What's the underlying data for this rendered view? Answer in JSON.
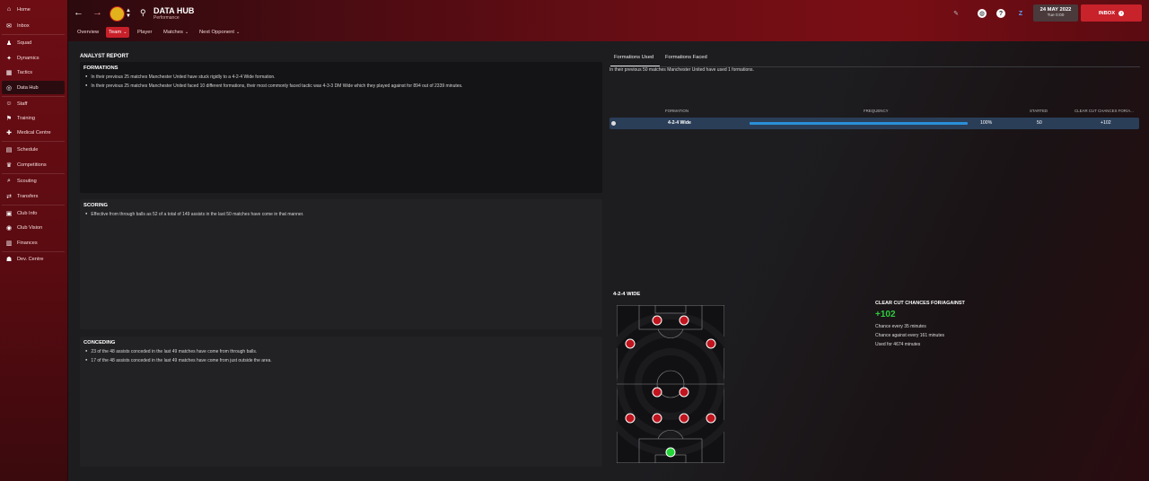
{
  "sidebar": {
    "items": [
      {
        "label": "Home",
        "icon": "home-icon",
        "glyph": "⌂"
      },
      {
        "label": "Inbox",
        "icon": "inbox-icon",
        "glyph": "✉"
      },
      {
        "label": "Squad",
        "icon": "squad-icon",
        "glyph": "♟"
      },
      {
        "label": "Dynamics",
        "icon": "dynamics-icon",
        "glyph": "✦"
      },
      {
        "label": "Tactics",
        "icon": "tactics-icon",
        "glyph": "▦"
      },
      {
        "label": "Data Hub",
        "icon": "data-hub-icon",
        "glyph": "◎"
      },
      {
        "label": "Staff",
        "icon": "staff-icon",
        "glyph": "☺"
      },
      {
        "label": "Training",
        "icon": "training-icon",
        "glyph": "⚑"
      },
      {
        "label": "Medical Centre",
        "icon": "medical-icon",
        "glyph": "✚"
      },
      {
        "label": "Schedule",
        "icon": "schedule-icon",
        "glyph": "▤"
      },
      {
        "label": "Competitions",
        "icon": "trophy-icon",
        "glyph": "♛"
      },
      {
        "label": "Scouting",
        "icon": "scouting-icon",
        "glyph": "⌕"
      },
      {
        "label": "Transfers",
        "icon": "transfers-icon",
        "glyph": "⇄"
      },
      {
        "label": "Club Info",
        "icon": "club-info-icon",
        "glyph": "▣"
      },
      {
        "label": "Club Vision",
        "icon": "club-vision-icon",
        "glyph": "◉"
      },
      {
        "label": "Finances",
        "icon": "finances-icon",
        "glyph": "▥"
      },
      {
        "label": "Dev. Centre",
        "icon": "dev-centre-icon",
        "glyph": "☗"
      }
    ]
  },
  "header": {
    "title": "DATA HUB",
    "subtitle": "Performance",
    "tabs": [
      "Overview",
      "Team",
      "Player",
      "Matches",
      "Next Opponent"
    ],
    "date": "24 MAY 2022",
    "day": "Tue 0:00",
    "inbox_label": "INBOX"
  },
  "report": {
    "heading": "ANALYST REPORT",
    "formations": {
      "title": "FORMATIONS",
      "bullets": [
        "In their previous 25 matches Manchester United have stuck rigidly to a 4-2-4 Wide formation.",
        "In their previous 25 matches Manchester United faced 10 different formations, their most commonly faced tactic was 4-3-3 DM Wide which they played against for 894 out of 2339 minutes."
      ]
    },
    "scoring": {
      "title": "SCORING",
      "bullets": [
        "Effective from through balls as 52 of a total of 149 assists in the last 50 matches have come in that manner."
      ]
    },
    "conceding": {
      "title": "CONCEDING",
      "bullets": [
        "23 of the 48 assists conceded in the last 49 matches have come from through balls.",
        "17 of the 48 assists conceded in the last 49 matches have come from just outside the area."
      ]
    }
  },
  "formations_panel": {
    "tabs": [
      "Formations Used",
      "Formations Faced"
    ],
    "summary": "In their previous 50 matches Manchester United have used 1 formations.",
    "columns": [
      "FORMATION",
      "FREQUENCY",
      "STARTED",
      "CLEAR CUT CHANCES FOR/A..."
    ],
    "rows": [
      {
        "formation": "4-2-4 Wide",
        "frequency_pct": 100,
        "frequency_label": "100%",
        "started": "50",
        "ccc": "+102"
      }
    ],
    "pitch_title": "4-2-4 WIDE",
    "ccc_title": "CLEAR CUT CHANCES FOR/AGAINST",
    "ccc_value": "+102",
    "ccc_lines": [
      "Chance every 35 minutes",
      "Chance against every 161 minutes",
      "Used for 4674 minutes"
    ]
  },
  "colors": {
    "accent": "#c8202a",
    "player": "#c0151f",
    "keeper": "#25d63a",
    "bar": "#2b8fd8"
  }
}
